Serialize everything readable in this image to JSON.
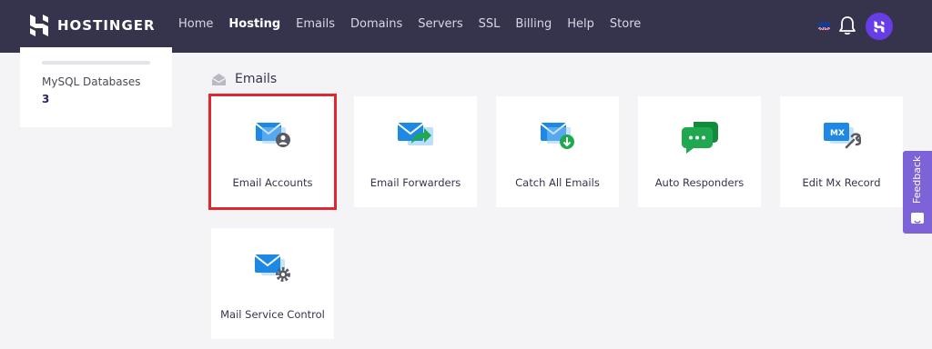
{
  "header": {
    "brand": "HOSTINGER",
    "nav": [
      "Home",
      "Hosting",
      "Emails",
      "Domains",
      "Servers",
      "SSL",
      "Billing",
      "Help",
      "Store"
    ],
    "active_nav": "Hosting",
    "icons": [
      "uk-flag-icon",
      "bell-icon",
      "avatar-icon"
    ]
  },
  "sidebar": {
    "mysql_label": "MySQL Databases",
    "mysql_value": "3"
  },
  "section": {
    "title": "Emails",
    "icon": "envelope-open-icon"
  },
  "tiles": [
    {
      "label": "Email Accounts",
      "icon": "email-accounts-icon",
      "selected": true
    },
    {
      "label": "Email Forwarders",
      "icon": "email-forwarders-icon",
      "selected": false
    },
    {
      "label": "Catch All Emails",
      "icon": "catch-all-emails-icon",
      "selected": false
    },
    {
      "label": "Auto Responders",
      "icon": "auto-responders-icon",
      "selected": false
    },
    {
      "label": "Edit Mx Record",
      "icon": "edit-mx-record-icon",
      "selected": false
    },
    {
      "label": "Mail Service Control",
      "icon": "mail-service-control-icon",
      "selected": false
    }
  ],
  "feedback": {
    "label": "Feedback"
  },
  "colors": {
    "topbar": "#36344d",
    "accent": "#673de6",
    "highlight": "#e0262e",
    "feedback": "#7e63d8",
    "email_blue": "#1e88e5",
    "chat_green": "#1fa84f"
  }
}
